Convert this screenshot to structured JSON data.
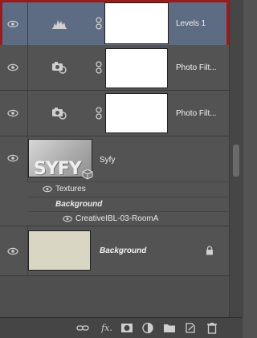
{
  "layers": [
    {
      "name": "Levels 1",
      "kind": "adjustment-levels",
      "selected": true
    },
    {
      "name": "Photo Filt...",
      "kind": "adjustment-photo-filter"
    },
    {
      "name": "Photo Filt...",
      "kind": "adjustment-photo-filter"
    },
    {
      "name": "Syfy",
      "kind": "smart-object",
      "children": [
        {
          "name": "Textures"
        },
        {
          "name": "Background"
        },
        {
          "name": "CreativeIBL-03-RoomA"
        }
      ]
    },
    {
      "name": "Background",
      "kind": "background",
      "locked": true
    }
  ],
  "thumbs": {
    "syfy_text": "SYFY"
  },
  "icons": {
    "visibility": "eye-icon",
    "levels": "levels-icon",
    "photo_filter": "photo-filter-icon",
    "link": "link-icon",
    "smart_object": "smart-object-icon",
    "lock": "lock-icon"
  },
  "toolbar": {
    "fx_label": "fx."
  },
  "colors": {
    "panel": "#535353",
    "selected_row": "#5d6b83",
    "selection_border": "#9b1b1b",
    "background_thumb": "#d9d6c4"
  }
}
